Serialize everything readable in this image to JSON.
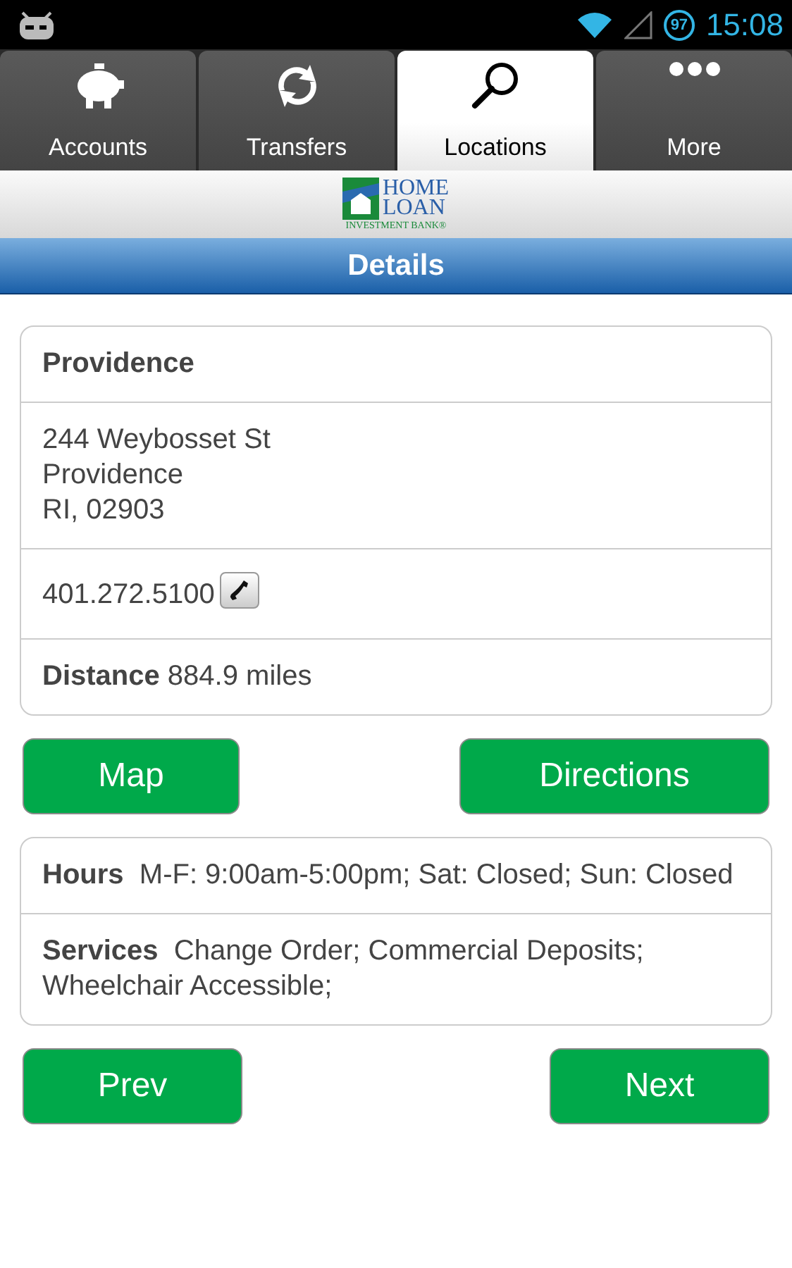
{
  "status_bar": {
    "battery": "97",
    "time": "15:08"
  },
  "tabs": [
    {
      "label": "Accounts",
      "selected": false
    },
    {
      "label": "Transfers",
      "selected": false
    },
    {
      "label": "Locations",
      "selected": true
    },
    {
      "label": "More",
      "selected": false
    }
  ],
  "logo": {
    "line1": "HOME",
    "line2": "LOAN",
    "line3": "INVESTMENT BANK®"
  },
  "header": {
    "title": "Details"
  },
  "location": {
    "name": "Providence",
    "address": [
      "244 Weybosset St",
      "Providence",
      "RI, 02903"
    ],
    "phone": "401.272.5100",
    "distance_label": "Distance",
    "distance": "884.9 miles"
  },
  "action_buttons": [
    "Map",
    "Directions"
  ],
  "info": [
    {
      "label": "Hours",
      "value": "M-F: 9:00am-5:00pm; Sat: Closed; Sun: Closed"
    },
    {
      "label": "Services",
      "value": "Change Order; Commercial Deposits; Wheelchair Accessible;"
    }
  ],
  "nav_buttons": [
    "Prev",
    "Next"
  ]
}
